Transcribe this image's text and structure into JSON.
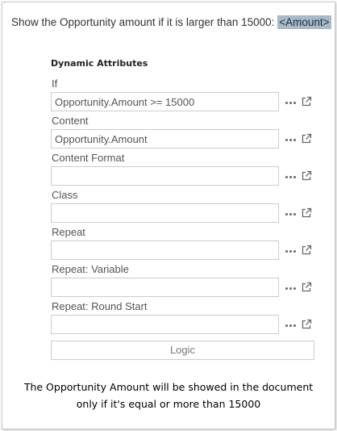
{
  "document": {
    "text": "Show the Opportunity amount if it is larger than 15000: ",
    "merge_field": "<Amount>",
    "merge_field_color": "#a8b9c8"
  },
  "panel": {
    "title": "Dynamic Attributes",
    "fields": [
      {
        "label": "If",
        "value": "Opportunity.Amount >= 15000"
      },
      {
        "label": "Content",
        "value": "Opportunity.Amount"
      },
      {
        "label": "Content Format",
        "value": ""
      },
      {
        "label": "Class",
        "value": ""
      },
      {
        "label": "Repeat",
        "value": ""
      },
      {
        "label": "Repeat: Variable",
        "value": ""
      },
      {
        "label": "Repeat: Round Start",
        "value": ""
      }
    ],
    "field_actions": {
      "more_icon": "ellipsis-icon",
      "open_icon": "external-link-icon"
    },
    "logic_button": "Logic"
  },
  "caption": {
    "line1": "The Opportunity Amount will be showed in the document",
    "line2": "only if it's equal or more than 15000"
  }
}
